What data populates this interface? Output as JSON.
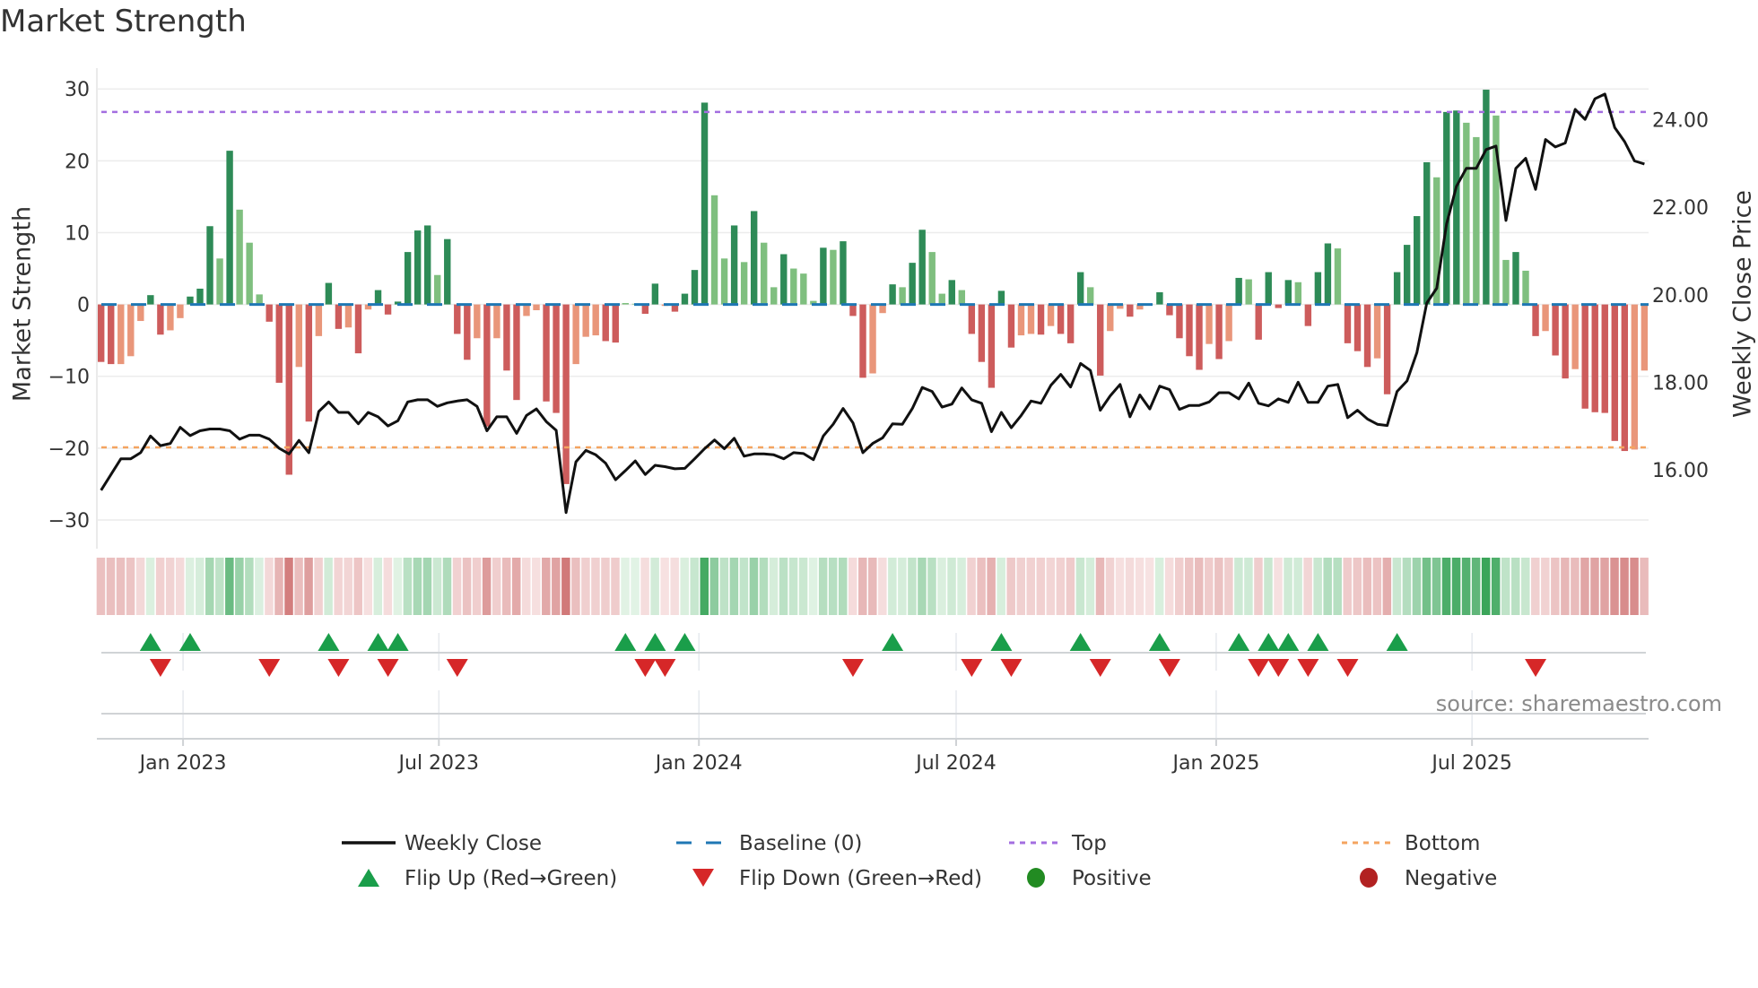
{
  "title": "Market Strength",
  "source": "source: sharemaestro.com",
  "legend": [
    {
      "label": "Weekly Close",
      "kind": "line",
      "color": "#111111"
    },
    {
      "label": "Baseline (0)",
      "kind": "dash",
      "color": "#1f77b4"
    },
    {
      "label": "Top",
      "kind": "dot",
      "color": "#a36ee0"
    },
    {
      "label": "Bottom",
      "kind": "dot",
      "color": "#f4a460"
    },
    {
      "label": "Flip Up (Red→Green)",
      "kind": "tri-up",
      "color": "#1a9e4a"
    },
    {
      "label": "Flip Down (Green→Red)",
      "kind": "tri-down",
      "color": "#d62728"
    },
    {
      "label": "Positive",
      "kind": "circle",
      "color": "#228b22"
    },
    {
      "label": "Negative",
      "kind": "circle",
      "color": "#b22222"
    }
  ],
  "chart_data": {
    "type": "bar",
    "title": "Market Strength",
    "ylabel": "Market Strength",
    "y2label": "Weekly Close Price",
    "ylim": [
      -32.5,
      32.4
    ],
    "y2lim": [
      14.44,
      25.1
    ],
    "yticks": [
      -30,
      -20,
      -10,
      0,
      10,
      20,
      30
    ],
    "y2ticks": [
      "16.00",
      "18.00",
      "20.00",
      "22.00",
      "24.00"
    ],
    "xticks": [
      {
        "label": "Jan 2023",
        "date": "2023-01-01"
      },
      {
        "label": "Jul 2023",
        "date": "2023-07-01"
      },
      {
        "label": "Jan 2024",
        "date": "2024-01-01"
      },
      {
        "label": "Jul 2024",
        "date": "2024-07-01"
      },
      {
        "label": "Jan 2025",
        "date": "2025-01-01"
      },
      {
        "label": "Jul 2025",
        "date": "2025-07-01"
      }
    ],
    "start_date": "2022-11-04",
    "frequency": "weekly",
    "top": 26.8,
    "bottom": -19.9,
    "baseline": 0,
    "colors": {
      "pos_strong": "#2e8b57",
      "pos_weak": "#7fbf7f",
      "neg_strong": "#cd5c5c",
      "neg_weak": "#e9967a"
    },
    "strength": [
      -8.0,
      -8.3,
      -8.3,
      -7.2,
      -2.3,
      1.3,
      -4.2,
      -3.6,
      -1.9,
      1.1,
      2.2,
      10.9,
      6.4,
      21.4,
      13.2,
      8.6,
      1.4,
      -2.4,
      -10.9,
      -23.7,
      -8.7,
      -16.3,
      -4.4,
      3.0,
      -3.4,
      -3.2,
      -6.8,
      -0.7,
      2.0,
      -1.4,
      0.4,
      7.3,
      10.3,
      11.0,
      4.1,
      9.1,
      -4.1,
      -7.7,
      -4.7,
      -17.0,
      -4.7,
      -9.2,
      -13.3,
      -1.6,
      -0.8,
      -13.5,
      -15.1,
      -25.0,
      -8.3,
      -4.5,
      -4.3,
      -5.1,
      -5.3,
      0.2,
      0.1,
      -1.3,
      2.9,
      -0.2,
      -1.0,
      1.5,
      4.8,
      28.1,
      15.2,
      6.4,
      11.0,
      5.9,
      13.0,
      8.6,
      2.4,
      7.0,
      5.0,
      4.3,
      0.5,
      7.9,
      7.6,
      8.8,
      -1.6,
      -10.2,
      -9.6,
      -1.2,
      2.8,
      2.4,
      5.8,
      10.4,
      7.3,
      1.5,
      3.4,
      2.0,
      -4.1,
      -8.0,
      -11.6,
      1.9,
      -6.0,
      -4.3,
      -4.1,
      -4.2,
      -3.0,
      -4.1,
      -5.4,
      4.5,
      2.4,
      -9.9,
      -3.7,
      -0.6,
      -1.7,
      -0.7,
      0.0,
      1.7,
      -1.5,
      -4.7,
      -7.2,
      -9.1,
      -5.5,
      -7.6,
      -5.1,
      3.7,
      3.5,
      -4.9,
      4.5,
      -0.5,
      3.4,
      3.1,
      -3.0,
      4.5,
      8.5,
      7.8,
      -5.4,
      -6.5,
      -8.7,
      -7.5,
      -12.5,
      4.5,
      8.3,
      12.3,
      19.8,
      17.7,
      26.8,
      27.0,
      25.3,
      23.3,
      29.9,
      26.3,
      6.2,
      7.3,
      4.7,
      -4.4,
      -3.7,
      -7.1,
      -10.3,
      -9.0,
      -14.5,
      -15.0,
      -15.1,
      -19.0,
      -20.4,
      -20.2,
      -9.2
    ],
    "strong": [
      1,
      1,
      0,
      0,
      0,
      1,
      1,
      0,
      0,
      1,
      1,
      1,
      0,
      1,
      0,
      0,
      0,
      1,
      1,
      1,
      0,
      1,
      0,
      1,
      1,
      0,
      1,
      0,
      1,
      1,
      1,
      1,
      1,
      1,
      0,
      1,
      1,
      1,
      0,
      1,
      0,
      1,
      1,
      0,
      0,
      1,
      1,
      1,
      0,
      0,
      0,
      1,
      1,
      0,
      0,
      1,
      1,
      0,
      1,
      1,
      1,
      1,
      0,
      0,
      1,
      0,
      1,
      0,
      0,
      1,
      0,
      0,
      0,
      1,
      0,
      1,
      1,
      1,
      0,
      0,
      1,
      0,
      1,
      1,
      0,
      0,
      1,
      0,
      1,
      1,
      1,
      1,
      1,
      0,
      0,
      1,
      0,
      1,
      1,
      1,
      0,
      1,
      0,
      0,
      1,
      0,
      0,
      1,
      1,
      1,
      1,
      1,
      0,
      1,
      0,
      1,
      0,
      1,
      1,
      1,
      1,
      0,
      1,
      1,
      1,
      0,
      1,
      1,
      1,
      0,
      1,
      1,
      1,
      1,
      1,
      0,
      1,
      1,
      0,
      0,
      1,
      0,
      0,
      1,
      0,
      1,
      0,
      1,
      1,
      0,
      1,
      1,
      1,
      1,
      1,
      0,
      0
    ],
    "weekly_close": [
      15.53,
      15.89,
      16.25,
      16.25,
      16.39,
      16.77,
      16.55,
      16.6,
      16.97,
      16.78,
      16.89,
      16.93,
      16.93,
      16.89,
      16.7,
      16.79,
      16.79,
      16.7,
      16.49,
      16.36,
      16.67,
      16.39,
      17.33,
      17.55,
      17.31,
      17.31,
      17.05,
      17.31,
      17.21,
      17.0,
      17.12,
      17.55,
      17.6,
      17.6,
      17.45,
      17.53,
      17.57,
      17.6,
      17.45,
      16.89,
      17.21,
      17.21,
      16.83,
      17.24,
      17.39,
      17.1,
      16.9,
      15.02,
      16.18,
      16.44,
      16.34,
      16.15,
      15.77,
      15.98,
      16.2,
      15.89,
      16.1,
      16.07,
      16.02,
      16.03,
      16.25,
      16.48,
      16.68,
      16.48,
      16.72,
      16.31,
      16.36,
      16.36,
      16.34,
      16.25,
      16.39,
      16.37,
      16.23,
      16.77,
      17.04,
      17.4,
      17.07,
      16.39,
      16.6,
      16.73,
      17.05,
      17.04,
      17.4,
      17.88,
      17.79,
      17.43,
      17.5,
      17.87,
      17.6,
      17.52,
      16.87,
      17.31,
      16.96,
      17.24,
      17.57,
      17.52,
      17.93,
      18.18,
      17.89,
      18.43,
      18.27,
      17.36,
      17.69,
      17.95,
      17.21,
      17.71,
      17.39,
      17.91,
      17.83,
      17.38,
      17.47,
      17.47,
      17.55,
      17.76,
      17.76,
      17.62,
      17.98,
      17.52,
      17.46,
      17.62,
      17.54,
      18.0,
      17.54,
      17.54,
      17.91,
      17.95,
      17.19,
      17.36,
      17.16,
      17.04,
      17.01,
      17.79,
      18.03,
      18.68,
      19.81,
      20.15,
      21.62,
      22.48,
      22.89,
      22.89,
      23.32,
      23.4,
      21.7,
      22.89,
      23.12,
      22.41,
      23.55,
      23.38,
      23.47,
      24.24,
      24.01,
      24.48,
      24.59,
      23.82,
      23.5,
      23.06,
      22.99
    ],
    "flip_up_weeks": [
      6,
      10,
      24,
      29,
      31,
      54,
      57,
      60,
      81,
      92,
      100,
      108,
      116,
      119,
      121,
      124,
      132
    ],
    "flip_down_weeks": [
      7,
      18,
      25,
      30,
      37,
      56,
      58,
      77,
      89,
      93,
      102,
      109,
      118,
      120,
      123,
      127,
      146
    ]
  }
}
